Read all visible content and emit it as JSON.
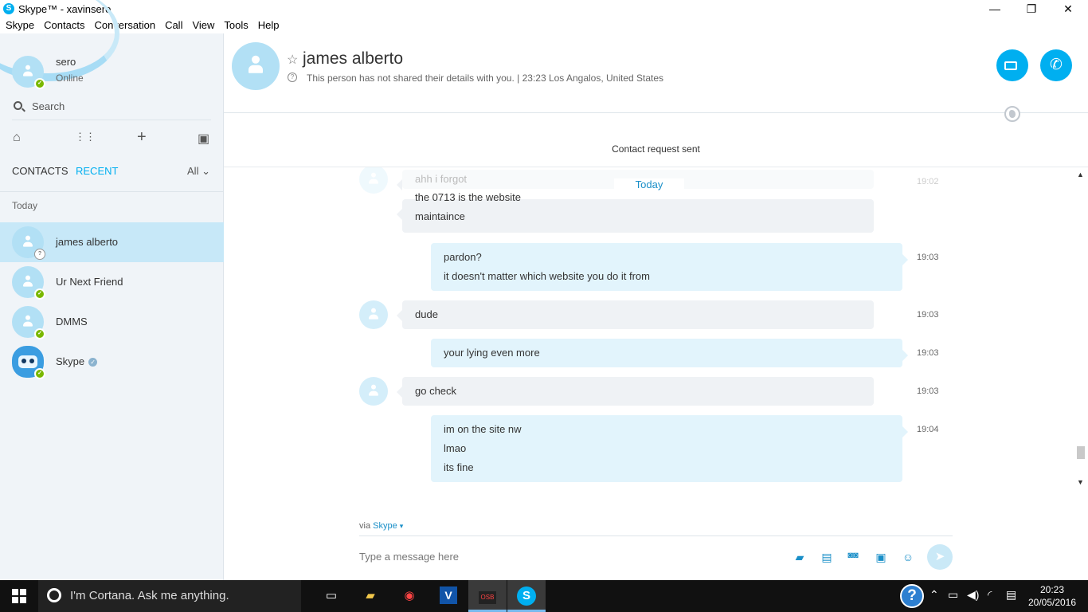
{
  "window": {
    "title": "Skype™ - xavinsero",
    "minimize": "—",
    "restore": "❐",
    "close": "✕"
  },
  "menu": [
    "Skype",
    "Contacts",
    "Conversation",
    "Call",
    "View",
    "Tools",
    "Help"
  ],
  "profile": {
    "name": "sero",
    "status": "Online"
  },
  "search": {
    "label": "Search"
  },
  "tabs": {
    "contacts": "CONTACTS",
    "recent": "RECENT",
    "filter": "All"
  },
  "section_label": "Today",
  "contacts": [
    {
      "name": "james alberto",
      "presence": "unknown"
    },
    {
      "name": "Ur Next Friend",
      "presence": "online"
    },
    {
      "name": "DMMS",
      "presence": "online"
    },
    {
      "name": "Skype",
      "presence": "online",
      "verified": true
    }
  ],
  "chat": {
    "name": "james alberto",
    "info": "This person has not shared their details with you.  |  23:23 Los Angalos, United States",
    "request": "Contact request sent",
    "day": "Today"
  },
  "messages": [
    {
      "from": "them",
      "lines": [
        "ahh i forgot"
      ],
      "time": "19:02",
      "partial": true
    },
    {
      "from": "them",
      "lines": [
        "the 0713 is the website",
        "maintaince"
      ],
      "time": ""
    },
    {
      "from": "me",
      "lines": [
        "pardon?",
        "it doesn't matter which website you do it from"
      ],
      "time": "19:03"
    },
    {
      "from": "them",
      "lines": [
        "dude"
      ],
      "time": "19:03"
    },
    {
      "from": "me",
      "lines": [
        "your lying even more"
      ],
      "time": "19:03"
    },
    {
      "from": "them",
      "lines": [
        "go check"
      ],
      "time": "19:03"
    },
    {
      "from": "me",
      "lines": [
        "im on the site nw",
        "lmao",
        "its fine"
      ],
      "time": "19:04"
    }
  ],
  "composer": {
    "via_prefix": "via",
    "via_service": "Skype",
    "placeholder": "Type a message here"
  },
  "taskbar": {
    "cortana": "I'm Cortana. Ask me anything.",
    "time": "20:23",
    "date": "20/05/2016",
    "obs": "OSB"
  },
  "colors": {
    "accent": "#00aff0",
    "selected": "#c7e8f8",
    "online": "#7ab800",
    "incoming": "#eff2f5",
    "outgoing": "#e2f4fc"
  }
}
